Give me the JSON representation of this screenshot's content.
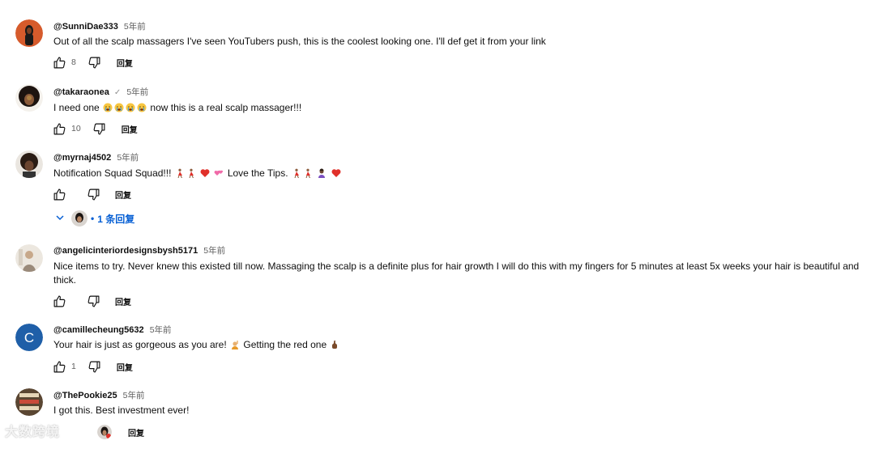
{
  "comments": [
    {
      "author": "@SunniDae333",
      "time": "5年前",
      "text": "Out of all the scalp massagers I've seen YouTubers push, this is the coolest looking one. I'll def get it from your link",
      "likes": "8",
      "reply_label": "回复",
      "avatar_color": "#d65b2c"
    },
    {
      "author": "@takaraonea",
      "verified_mark": "✓",
      "time": "5年前",
      "text_before_emoji": "I need one",
      "text_after_emoji": "now this is a real scalp massager!!!",
      "likes": "10",
      "reply_label": "回复",
      "avatar_color": "#2b1d18"
    },
    {
      "author": "@myrnaj4502",
      "time": "5年前",
      "text_part1": "Notification Squad Squad!!!",
      "text_part2": "Love the Tips.",
      "likes": "",
      "reply_label": "回复",
      "replies_label": "1 条回复",
      "avatar_color": "#3a2a1f"
    },
    {
      "author": "@angelicinteriordesignsbysh5171",
      "time": "5年前",
      "text": "Nice items to try.  Never knew this existed till now.  Massaging the scalp is a definite plus for hair growth I will do this with my fingers for 5 minutes at least 5x weeks your hair is beautiful and thick.",
      "likes": "",
      "reply_label": "回复",
      "avatar_color": "#e9e4dc"
    },
    {
      "author": "@camillecheung5632",
      "time": "5年前",
      "text_part1": "Your hair is just as gorgeous as you are!",
      "text_part2": "Getting the red one",
      "likes": "1",
      "reply_label": "回复",
      "avatar_letter": "C",
      "avatar_color": "#1f5fa8"
    },
    {
      "author": "@ThePookie25",
      "time": "5年前",
      "text": "I got this. Best investment ever!",
      "likes": "",
      "reply_label": "回复",
      "avatar_color": "#5a4632"
    }
  ],
  "colors": {
    "link_blue": "#065fd4",
    "secondary_text": "#606060",
    "primary_text": "#0f0f0f"
  },
  "icons": [
    "thumb-up-icon",
    "thumb-down-icon",
    "chevron-down-icon",
    "verified-icon"
  ],
  "watermark_text": "大数跨境"
}
